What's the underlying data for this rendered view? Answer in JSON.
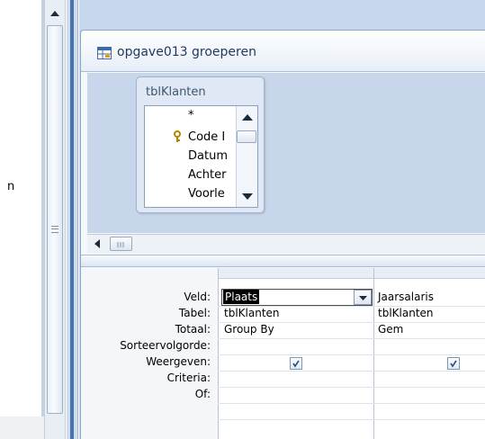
{
  "nav": {
    "item_text": "n"
  },
  "query_window": {
    "title": "opgave013 groeperen"
  },
  "table": {
    "name": "tblKlanten",
    "fields": [
      "*",
      "Code I",
      "Datum",
      "Achter",
      "Voorle"
    ]
  },
  "grid": {
    "row_labels": [
      "Veld:",
      "Tabel:",
      "Totaal:",
      "Sorteervolgorde:",
      "Weergeven:",
      "Criteria:",
      "Of:"
    ],
    "columns": [
      {
        "veld": "Plaats",
        "tabel": "tblKlanten",
        "totaal": "Group By",
        "weergeven": true
      },
      {
        "veld": "Jaarsalaris",
        "tabel": "tblKlanten",
        "totaal": "Gem",
        "weergeven": true
      }
    ]
  },
  "colors": {
    "frame_blue": "#4b74ad",
    "workspace": "#c6d7ee",
    "selected_cell": "#000000"
  },
  "icons": [
    "scroll-up-arrow-icon",
    "query-icon",
    "primary-key-icon",
    "scroll-left-arrow-icon",
    "dropdown-arrow-icon",
    "checkbox-checked-icon"
  ]
}
